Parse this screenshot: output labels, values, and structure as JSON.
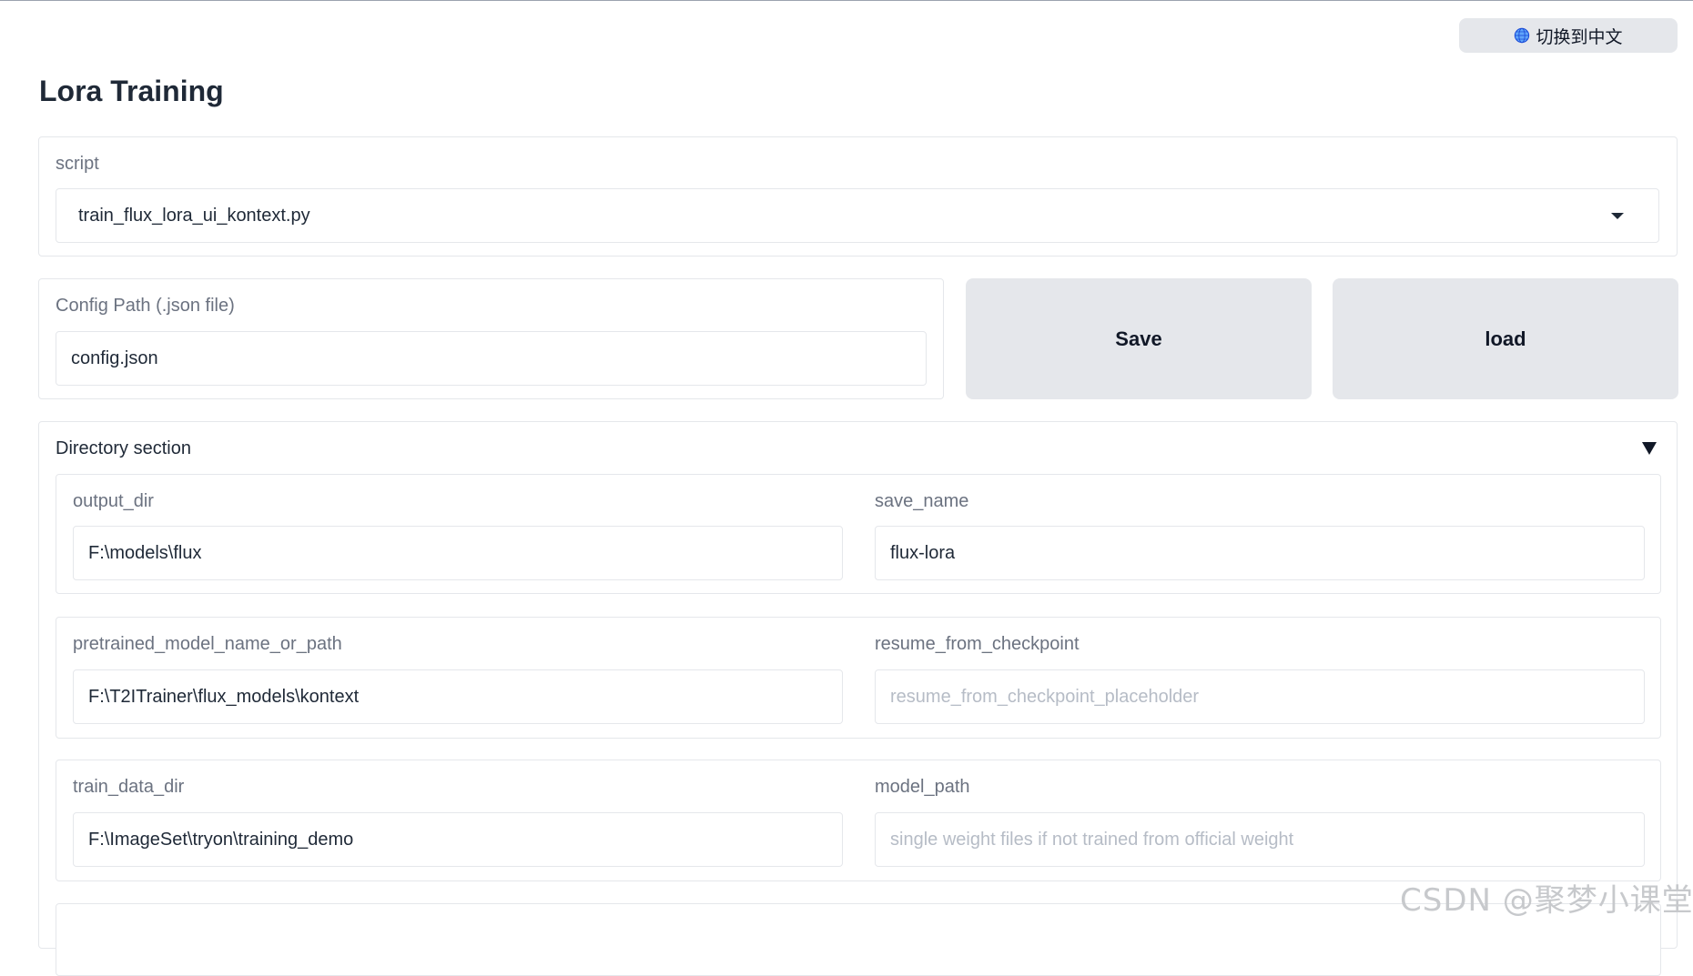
{
  "language_button": {
    "icon": "globe-icon",
    "label": "切换到中文"
  },
  "page": {
    "title": "Lora Training"
  },
  "script": {
    "label": "script",
    "value": "train_flux_lora_ui_kontext.py"
  },
  "config": {
    "label": "Config Path (.json file)",
    "value": "config.json"
  },
  "actions": {
    "save_label": "Save",
    "load_label": "load"
  },
  "directory_section": {
    "title": "Directory section",
    "fields": {
      "output_dir": {
        "label": "output_dir",
        "value": "F:\\models\\flux"
      },
      "save_name": {
        "label": "save_name",
        "value": "flux-lora"
      },
      "pretrained_model": {
        "label": "pretrained_model_name_or_path",
        "value": "F:\\T2ITrainer\\flux_models\\kontext"
      },
      "resume_from_checkpoint": {
        "label": "resume_from_checkpoint",
        "placeholder": "resume_from_checkpoint_placeholder"
      },
      "train_data_dir": {
        "label": "train_data_dir",
        "value": "F:\\ImageSet\\tryon\\training_demo"
      },
      "model_path": {
        "label": "model_path",
        "placeholder": "single weight files if not trained from official weight"
      }
    }
  },
  "watermark": "CSDN @聚梦小课堂"
}
